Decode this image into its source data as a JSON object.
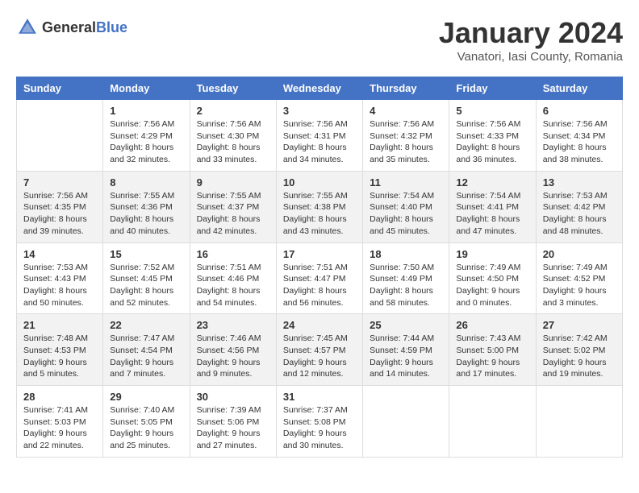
{
  "header": {
    "logo": {
      "general": "General",
      "blue": "Blue"
    },
    "title": "January 2024",
    "location": "Vanatori, Iasi County, Romania"
  },
  "weekdays": [
    "Sunday",
    "Monday",
    "Tuesday",
    "Wednesday",
    "Thursday",
    "Friday",
    "Saturday"
  ],
  "weeks": [
    [
      {
        "day": "",
        "sunrise": "",
        "sunset": "",
        "daylight": ""
      },
      {
        "day": "1",
        "sunrise": "Sunrise: 7:56 AM",
        "sunset": "Sunset: 4:29 PM",
        "daylight": "Daylight: 8 hours and 32 minutes."
      },
      {
        "day": "2",
        "sunrise": "Sunrise: 7:56 AM",
        "sunset": "Sunset: 4:30 PM",
        "daylight": "Daylight: 8 hours and 33 minutes."
      },
      {
        "day": "3",
        "sunrise": "Sunrise: 7:56 AM",
        "sunset": "Sunset: 4:31 PM",
        "daylight": "Daylight: 8 hours and 34 minutes."
      },
      {
        "day": "4",
        "sunrise": "Sunrise: 7:56 AM",
        "sunset": "Sunset: 4:32 PM",
        "daylight": "Daylight: 8 hours and 35 minutes."
      },
      {
        "day": "5",
        "sunrise": "Sunrise: 7:56 AM",
        "sunset": "Sunset: 4:33 PM",
        "daylight": "Daylight: 8 hours and 36 minutes."
      },
      {
        "day": "6",
        "sunrise": "Sunrise: 7:56 AM",
        "sunset": "Sunset: 4:34 PM",
        "daylight": "Daylight: 8 hours and 38 minutes."
      }
    ],
    [
      {
        "day": "7",
        "sunrise": "Sunrise: 7:56 AM",
        "sunset": "Sunset: 4:35 PM",
        "daylight": "Daylight: 8 hours and 39 minutes."
      },
      {
        "day": "8",
        "sunrise": "Sunrise: 7:55 AM",
        "sunset": "Sunset: 4:36 PM",
        "daylight": "Daylight: 8 hours and 40 minutes."
      },
      {
        "day": "9",
        "sunrise": "Sunrise: 7:55 AM",
        "sunset": "Sunset: 4:37 PM",
        "daylight": "Daylight: 8 hours and 42 minutes."
      },
      {
        "day": "10",
        "sunrise": "Sunrise: 7:55 AM",
        "sunset": "Sunset: 4:38 PM",
        "daylight": "Daylight: 8 hours and 43 minutes."
      },
      {
        "day": "11",
        "sunrise": "Sunrise: 7:54 AM",
        "sunset": "Sunset: 4:40 PM",
        "daylight": "Daylight: 8 hours and 45 minutes."
      },
      {
        "day": "12",
        "sunrise": "Sunrise: 7:54 AM",
        "sunset": "Sunset: 4:41 PM",
        "daylight": "Daylight: 8 hours and 47 minutes."
      },
      {
        "day": "13",
        "sunrise": "Sunrise: 7:53 AM",
        "sunset": "Sunset: 4:42 PM",
        "daylight": "Daylight: 8 hours and 48 minutes."
      }
    ],
    [
      {
        "day": "14",
        "sunrise": "Sunrise: 7:53 AM",
        "sunset": "Sunset: 4:43 PM",
        "daylight": "Daylight: 8 hours and 50 minutes."
      },
      {
        "day": "15",
        "sunrise": "Sunrise: 7:52 AM",
        "sunset": "Sunset: 4:45 PM",
        "daylight": "Daylight: 8 hours and 52 minutes."
      },
      {
        "day": "16",
        "sunrise": "Sunrise: 7:51 AM",
        "sunset": "Sunset: 4:46 PM",
        "daylight": "Daylight: 8 hours and 54 minutes."
      },
      {
        "day": "17",
        "sunrise": "Sunrise: 7:51 AM",
        "sunset": "Sunset: 4:47 PM",
        "daylight": "Daylight: 8 hours and 56 minutes."
      },
      {
        "day": "18",
        "sunrise": "Sunrise: 7:50 AM",
        "sunset": "Sunset: 4:49 PM",
        "daylight": "Daylight: 8 hours and 58 minutes."
      },
      {
        "day": "19",
        "sunrise": "Sunrise: 7:49 AM",
        "sunset": "Sunset: 4:50 PM",
        "daylight": "Daylight: 9 hours and 0 minutes."
      },
      {
        "day": "20",
        "sunrise": "Sunrise: 7:49 AM",
        "sunset": "Sunset: 4:52 PM",
        "daylight": "Daylight: 9 hours and 3 minutes."
      }
    ],
    [
      {
        "day": "21",
        "sunrise": "Sunrise: 7:48 AM",
        "sunset": "Sunset: 4:53 PM",
        "daylight": "Daylight: 9 hours and 5 minutes."
      },
      {
        "day": "22",
        "sunrise": "Sunrise: 7:47 AM",
        "sunset": "Sunset: 4:54 PM",
        "daylight": "Daylight: 9 hours and 7 minutes."
      },
      {
        "day": "23",
        "sunrise": "Sunrise: 7:46 AM",
        "sunset": "Sunset: 4:56 PM",
        "daylight": "Daylight: 9 hours and 9 minutes."
      },
      {
        "day": "24",
        "sunrise": "Sunrise: 7:45 AM",
        "sunset": "Sunset: 4:57 PM",
        "daylight": "Daylight: 9 hours and 12 minutes."
      },
      {
        "day": "25",
        "sunrise": "Sunrise: 7:44 AM",
        "sunset": "Sunset: 4:59 PM",
        "daylight": "Daylight: 9 hours and 14 minutes."
      },
      {
        "day": "26",
        "sunrise": "Sunrise: 7:43 AM",
        "sunset": "Sunset: 5:00 PM",
        "daylight": "Daylight: 9 hours and 17 minutes."
      },
      {
        "day": "27",
        "sunrise": "Sunrise: 7:42 AM",
        "sunset": "Sunset: 5:02 PM",
        "daylight": "Daylight: 9 hours and 19 minutes."
      }
    ],
    [
      {
        "day": "28",
        "sunrise": "Sunrise: 7:41 AM",
        "sunset": "Sunset: 5:03 PM",
        "daylight": "Daylight: 9 hours and 22 minutes."
      },
      {
        "day": "29",
        "sunrise": "Sunrise: 7:40 AM",
        "sunset": "Sunset: 5:05 PM",
        "daylight": "Daylight: 9 hours and 25 minutes."
      },
      {
        "day": "30",
        "sunrise": "Sunrise: 7:39 AM",
        "sunset": "Sunset: 5:06 PM",
        "daylight": "Daylight: 9 hours and 27 minutes."
      },
      {
        "day": "31",
        "sunrise": "Sunrise: 7:37 AM",
        "sunset": "Sunset: 5:08 PM",
        "daylight": "Daylight: 9 hours and 30 minutes."
      },
      {
        "day": "",
        "sunrise": "",
        "sunset": "",
        "daylight": ""
      },
      {
        "day": "",
        "sunrise": "",
        "sunset": "",
        "daylight": ""
      },
      {
        "day": "",
        "sunrise": "",
        "sunset": "",
        "daylight": ""
      }
    ]
  ]
}
